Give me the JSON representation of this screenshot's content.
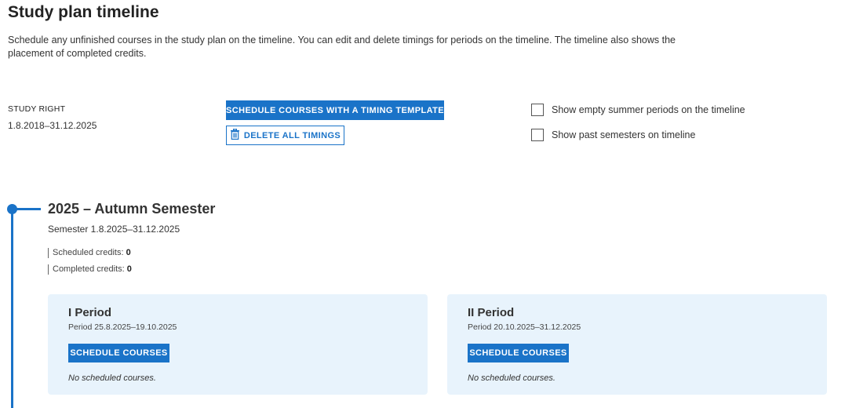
{
  "page": {
    "title": "Study plan timeline",
    "intro": "Schedule any unfinished courses in the study plan on the timeline. You can edit and delete timings for periods on the timeline. The timeline also shows the placement of completed credits."
  },
  "study_right": {
    "label": "STUDY RIGHT",
    "dates": "1.8.2018–31.12.2025"
  },
  "actions": {
    "schedule_template_label": "SCHEDULE COURSES WITH A TIMING TEMPLATE",
    "delete_timings_label": "DELETE ALL TIMINGS",
    "delete_icon": "trash-icon"
  },
  "options": [
    {
      "label": "Show empty summer periods on the timeline",
      "checked": false
    },
    {
      "label": "Show past semesters on timeline",
      "checked": false
    }
  ],
  "colors": {
    "accent": "#1a73c8",
    "card_bg": "#e8f3fc"
  },
  "semester": {
    "title": "2025 – Autumn Semester",
    "dates": "Semester 1.8.2025–31.12.2025",
    "scheduled_label": "Scheduled credits:",
    "scheduled_value": "0",
    "completed_label": "Completed credits:",
    "completed_value": "0",
    "periods": [
      {
        "title": "I Period",
        "dates": "Period 25.8.2025–19.10.2025",
        "button": "SCHEDULE COURSES",
        "empty_text": "No scheduled courses."
      },
      {
        "title": "II Period",
        "dates": "Period 20.10.2025–31.12.2025",
        "button": "SCHEDULE COURSES",
        "empty_text": "No scheduled courses."
      }
    ]
  }
}
